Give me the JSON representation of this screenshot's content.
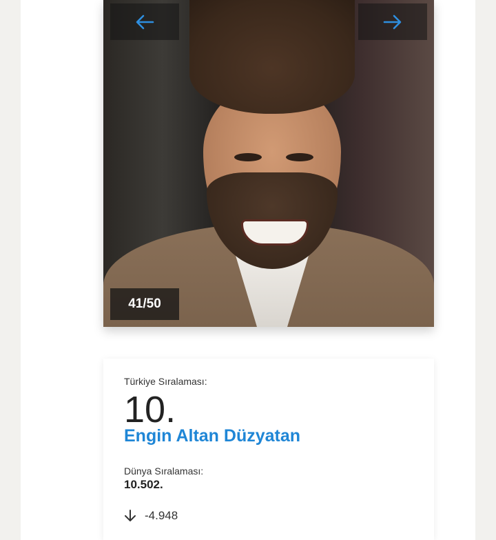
{
  "gallery": {
    "counter": "41/50",
    "prev_icon": "arrow-left-icon",
    "next_icon": "arrow-right-icon",
    "accent_color": "#1f86d6"
  },
  "ranking": {
    "turkey_label": "Türkiye Sıralaması:",
    "turkey_rank": "10.",
    "name": "Engin Altan Düzyatan",
    "world_label": "Dünya Sıralaması:",
    "world_rank": "10.502.",
    "change_icon": "arrow-down-icon",
    "change_value": "-4.948"
  }
}
